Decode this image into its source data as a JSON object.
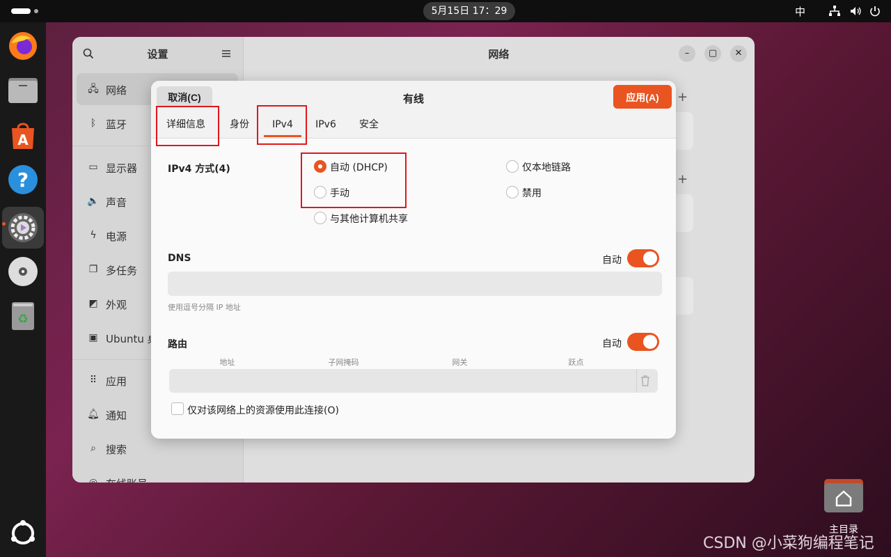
{
  "topbar": {
    "clock": "5月15日  17：29",
    "ime": "中"
  },
  "dock": {
    "items": [
      "firefox-icon",
      "files-icon",
      "app-center-icon",
      "help-icon",
      "settings-icon",
      "disc-icon",
      "trash-icon"
    ],
    "apps_grid": "show-apps-icon"
  },
  "settings": {
    "sidebar_title": "设置",
    "main_title": "网络",
    "sidebar_items": [
      {
        "label": "网络",
        "icon": "network-icon"
      },
      {
        "label": "蓝牙",
        "icon": "bluetooth-icon"
      },
      {
        "label": "显示器",
        "icon": "display-icon"
      },
      {
        "label": "声音",
        "icon": "sound-icon"
      },
      {
        "label": "电源",
        "icon": "power-icon"
      },
      {
        "label": "多任务",
        "icon": "multitask-icon"
      },
      {
        "label": "外观",
        "icon": "appearance-icon"
      },
      {
        "label": "Ubuntu 桌面",
        "icon": "desktop-icon"
      },
      {
        "label": "应用",
        "icon": "apps-icon"
      },
      {
        "label": "通知",
        "icon": "bell-icon"
      },
      {
        "label": "搜索",
        "icon": "search-icon"
      },
      {
        "label": "在线账号",
        "icon": "accounts-icon"
      }
    ]
  },
  "dialog": {
    "title": "有线",
    "cancel_label": "取消(C)",
    "apply_label": "应用(A)",
    "tabs": [
      "详细信息",
      "身份",
      "IPv4",
      "IPv6",
      "安全"
    ],
    "selected_tab": "IPv4",
    "ipv4_method_label": "IPv4 方式(4)",
    "methods": [
      {
        "label": "自动 (DHCP)",
        "checked": true
      },
      {
        "label": "手动",
        "checked": false
      },
      {
        "label": "与其他计算机共享",
        "checked": false
      },
      {
        "label": "仅本地链路",
        "checked": false
      },
      {
        "label": "禁用",
        "checked": false
      }
    ],
    "dns_label": "DNS",
    "dns_auto_label": "自动",
    "dns_value": "",
    "dns_hint": "使用逗号分隔 IP 地址",
    "routes_label": "路由",
    "routes_auto_label": "自动",
    "route_columns": [
      "地址",
      "子网掩码",
      "网关",
      "跃点"
    ],
    "only_local_label": "仅对该网络上的资源使用此连接(O)"
  },
  "desktop": {
    "home_label": "主目录",
    "watermark": "CSDN @小菜狗编程笔记"
  },
  "colors": {
    "accent": "#e95420",
    "highlight": "#e0161b"
  }
}
